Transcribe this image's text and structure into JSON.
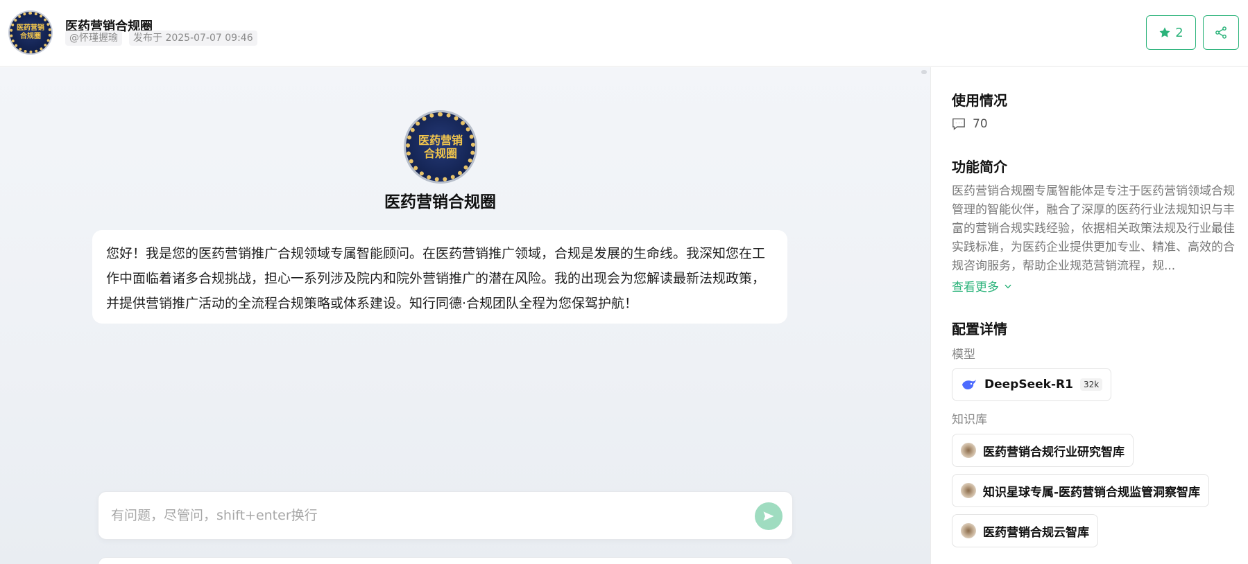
{
  "header": {
    "avatar_text": "医药营销合规圈",
    "title": "医药营销合规圈",
    "author": "@怀瑾握瑜",
    "published": "发布于 2025-07-07 09:46",
    "star_count": "2",
    "star_icon": "star-icon",
    "share_icon": "share-icon",
    "accent_color": "#2bb37a"
  },
  "chat": {
    "bot_avatar_text": "医药营销合规圈",
    "bot_name": "医药营销合规圈",
    "welcome_message": "您好！我是您的医药营销推广合规领域专属智能顾问。在医药营销推广领域，合规是发展的生命线。我深知您在工作中面临着诸多合规挑战，担心一系列涉及院内和院外营销推广的潜在风险。我的出现会为您解读最新法规政策，并提供营销推广活动的全流程合规策略或体系建设。知行同德·合规团队全程为您保驾护航！",
    "input_placeholder": "有问题，尽管问，shift+enter换行",
    "send_icon": "send-icon"
  },
  "sidebar": {
    "usage_title": "使用情况",
    "usage_icon": "comment-icon",
    "usage_count": "70",
    "intro_title": "功能简介",
    "intro_text": "医药营销合规圈专属智能体是专注于医药营销领域合规管理的智能伙伴，融合了深厚的医药行业法规知识与丰富的营销合规实践经验，依据相关政策法规及行业最佳实践标准，为医药企业提供更加专业、精准、高效的合规咨询服务，帮助企业规范营销流程，规...",
    "more_label": "查看更多",
    "config_title": "配置详情",
    "model_label": "模型",
    "model_name": "DeepSeek-R1",
    "model_context": "32k",
    "kb_label": "知识库",
    "knowledge_bases": [
      "医药营销合规行业研究智库",
      "知识星球专属-医药营销合规监管洞察智库",
      "医药营销合规云智库"
    ]
  }
}
